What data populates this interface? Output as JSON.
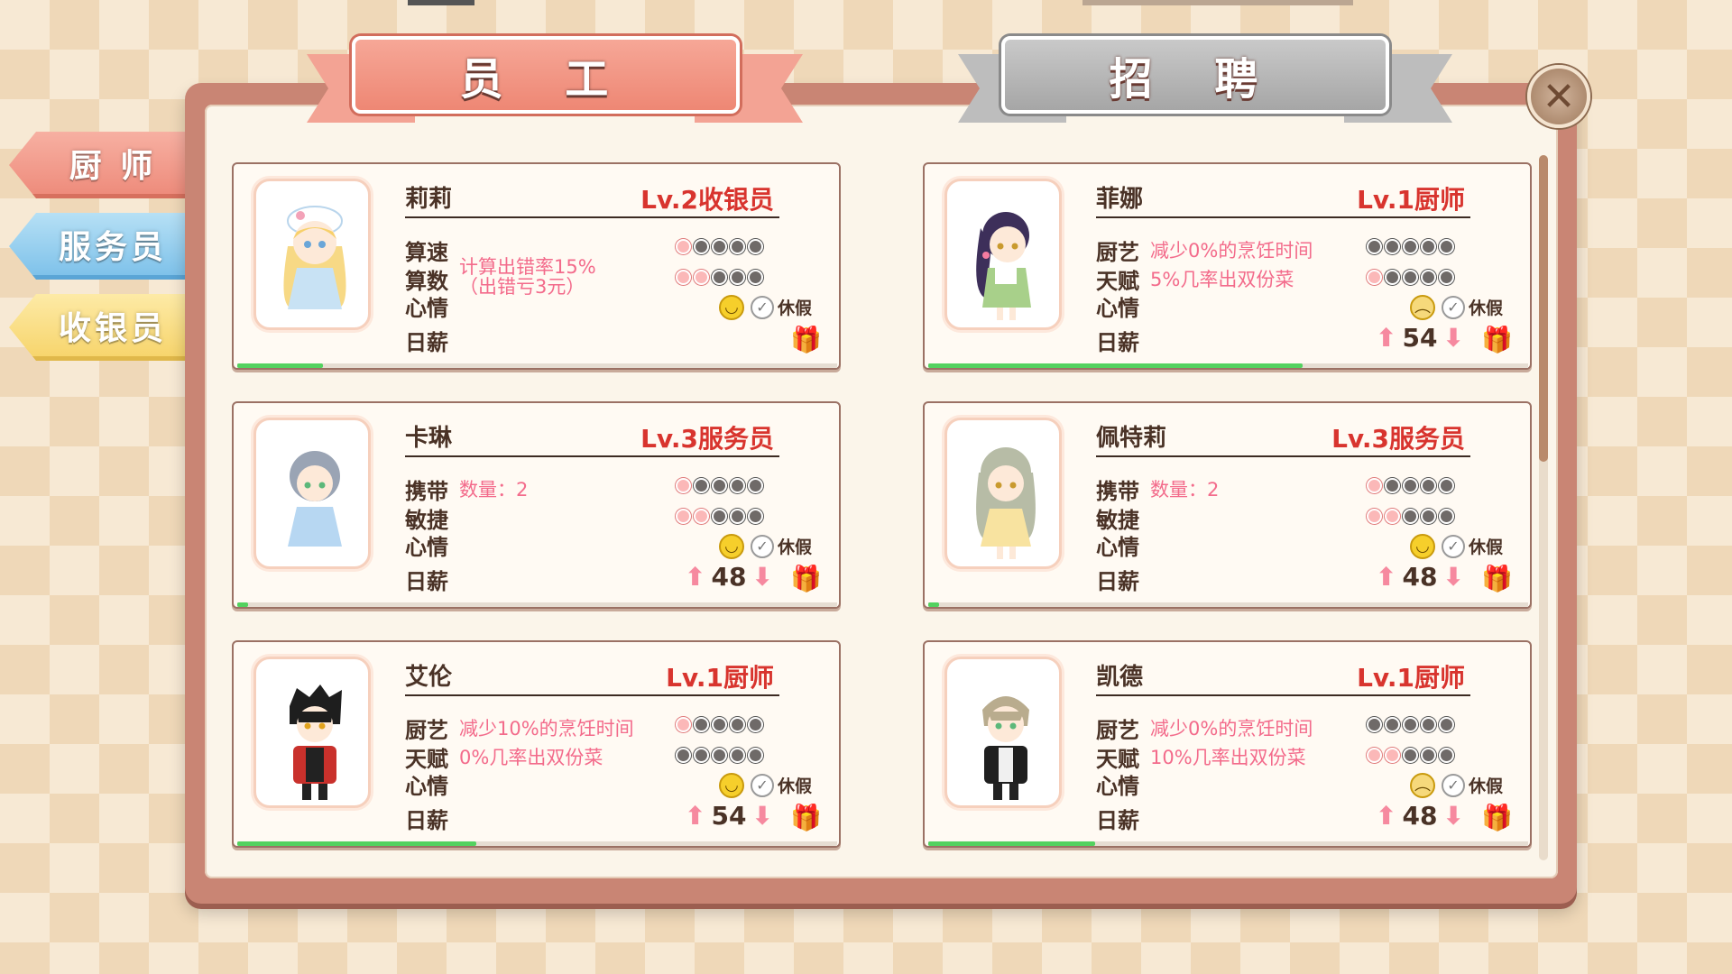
{
  "side_tabs": [
    {
      "label": "厨 师",
      "color": "#ee8c7c"
    },
    {
      "label": "服务员",
      "color": "#7fc2ea"
    },
    {
      "label": "收银员",
      "color": "#f7d56d"
    }
  ],
  "header": {
    "staff_tab": "员 工",
    "hire_tab": "招 聘",
    "close_icon": "close-icon"
  },
  "colors": {
    "level_text": "#d8342e",
    "desc_text": "#f36b8b",
    "progress": "#53d25f"
  },
  "cards": [
    {
      "name": "莉莉",
      "level": "Lv.2收银员",
      "row1_label": "算速",
      "row1_desc": "",
      "row2_label": "算数",
      "row2_desc": "计算出错率15%（出错亏3元）",
      "row2_desc_line1": "计算出错率15%",
      "row2_desc_line2": "（出错亏3元）",
      "mood_label": "心情",
      "vacation": "休假",
      "salary_label": "日薪",
      "salary": "",
      "stat1": 1,
      "stat2": 2,
      "mood": "happy",
      "progress": 0.12
    },
    {
      "name": "菲娜",
      "level": "Lv.1厨师",
      "row1_label": "厨艺",
      "row1_desc": "减少0%的烹饪时间",
      "row2_label": "天赋",
      "row2_desc": "5%几率出双份菜",
      "mood_label": "心情",
      "vacation": "休假",
      "salary_label": "日薪",
      "salary": "54",
      "stat1": 0,
      "stat2": 1,
      "mood": "sad",
      "progress": 0.51
    },
    {
      "name": "卡琳",
      "level": "Lv.3服务员",
      "row1_label": "携带",
      "row1_desc": "数量：2",
      "row2_label": "敏捷",
      "row2_desc": "",
      "mood_label": "心情",
      "vacation": "休假",
      "salary_label": "日薪",
      "salary": "48",
      "stat1": 1,
      "stat2": 2,
      "mood": "happy",
      "progress": 0.02
    },
    {
      "name": "佩特莉",
      "level": "Lv.3服务员",
      "row1_label": "携带",
      "row1_desc": "数量：2",
      "row2_label": "敏捷",
      "row2_desc": "",
      "mood_label": "心情",
      "vacation": "休假",
      "salary_label": "日薪",
      "salary": "48",
      "stat1": 1,
      "stat2": 2,
      "mood": "happy",
      "progress": 0.02
    },
    {
      "name": "艾伦",
      "level": "Lv.1厨师",
      "row1_label": "厨艺",
      "row1_desc": "减少10%的烹饪时间",
      "row2_label": "天赋",
      "row2_desc": "0%几率出双份菜",
      "mood_label": "心情",
      "vacation": "休假",
      "salary_label": "日薪",
      "salary": "54",
      "stat1": 1,
      "stat2": 0,
      "mood": "happy",
      "progress": 0.33
    },
    {
      "name": "凯德",
      "level": "Lv.1厨师",
      "row1_label": "厨艺",
      "row1_desc": "减少0%的烹饪时间",
      "row2_label": "天赋",
      "row2_desc": "10%几率出双份菜",
      "mood_label": "心情",
      "vacation": "休假",
      "salary_label": "日薪",
      "salary": "48",
      "stat1": 0,
      "stat2": 2,
      "mood": "sad",
      "progress": 0.23
    }
  ]
}
